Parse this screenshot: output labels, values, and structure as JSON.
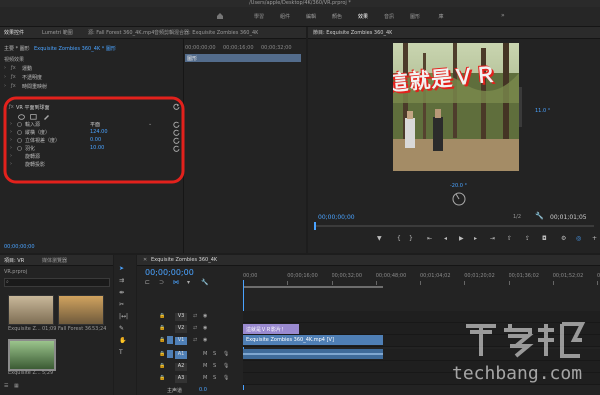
{
  "window": {
    "title": "/Users/apple/Desktop/4K/360/VR.prproj *"
  },
  "workspace_tabs": [
    "學習",
    "組件",
    "編輯",
    "顏色",
    "效果",
    "音訊",
    "圖形",
    "庫"
  ],
  "workspace_active": 4,
  "effect_controls": {
    "tabs": [
      "效果控件",
      "Lumetri 範圍",
      "源: Fall Forest 360_4K.mp4",
      "音頻剪輯混合器: Exquisite Zombies 360_4K"
    ],
    "master_label": "主要 * 圖形",
    "clip_label": "Exquisite Zombies 360_4K * 圖形",
    "mini_timecodes": [
      "00;00;00;00",
      "00;00;16;00",
      "00;00;32;00"
    ],
    "clip_bar_label": "圖形",
    "section": "視頻效果",
    "fx_rows": [
      "運動",
      "不透明度",
      "時間重映射"
    ],
    "vr_effect": "VR 平面到球面",
    "params": [
      {
        "label": "輸入源",
        "value": "平面",
        "dropdown": true
      },
      {
        "label": "縱橫（度）",
        "value": "124.00"
      },
      {
        "label": "立体視差（度）",
        "value": "0.00"
      },
      {
        "label": "羽化",
        "value": "10.00"
      },
      {
        "label": "旋轉源",
        "value": ""
      },
      {
        "label": "旋轉投影",
        "value": ""
      }
    ],
    "timecode": "00;00;00;00"
  },
  "program": {
    "title": "節目: Exquisite Zombies 360_4K",
    "overlay_text": "這就是ＶＲ",
    "angle_top": "11.0 °",
    "angle_bottom": "-20.0 °",
    "timecode_left": "00;00;00;00",
    "fit": "1/2",
    "timecode_right": "00;01;01;05"
  },
  "project": {
    "tabs": [
      "項目: VR",
      "媒体瀏覽器"
    ],
    "file": "VR.prproj",
    "search_placeholder": "",
    "items": [
      {
        "name": "Exquisite Z...",
        "duration": "01;09"
      },
      {
        "name": "Fall Forest 36...",
        "duration": "53;24"
      },
      {
        "name": "Exquisite Z...",
        "duration": "5;29"
      }
    ]
  },
  "timeline": {
    "sequence_name": "Exquisite Zombies 360_4K",
    "timecode": "00;00;00;00",
    "ruler": [
      "00;00",
      "00;00;16;00",
      "00;00;32;00",
      "00;00;48;00",
      "00;01;04;02",
      "00;01;20;02",
      "00;01;36;02",
      "00;01;52;02",
      "00;02;08;04"
    ],
    "tracks": [
      "V3",
      "V2",
      "V1",
      "A1",
      "A2",
      "A3"
    ],
    "title_clip": "這就是ＶＲ影片！",
    "video_clip": "Exquisite Zombies 360_4K.mp4 [V]",
    "master_label": "主声道",
    "master_value": "0.0"
  },
  "watermark": {
    "logo": "T客邦",
    "url": "techbang.com"
  },
  "colors": {
    "accent": "#2d8ceb",
    "clip_blue": "#4f7fb5",
    "clip_violet": "#9a8ad0",
    "annotation": "#e3211c",
    "overlay_text": "#f2f2f2"
  }
}
